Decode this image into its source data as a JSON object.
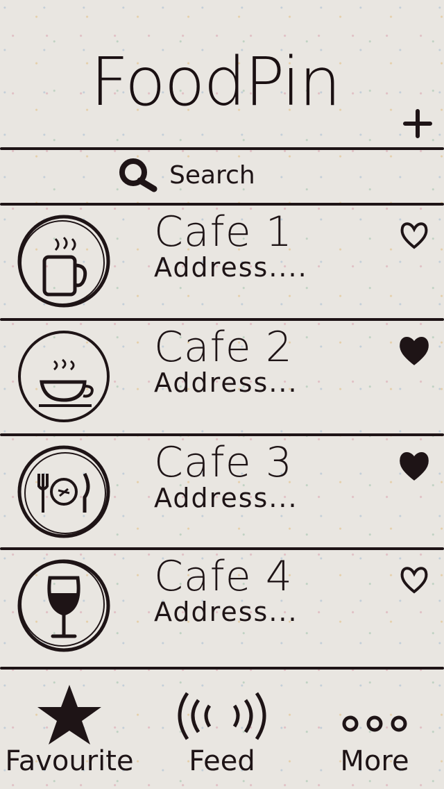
{
  "nav": {
    "title": "FoodPin",
    "add_icon": "plus-icon"
  },
  "search": {
    "placeholder": "Search",
    "icon": "search-icon"
  },
  "restaurants": [
    {
      "name": "Cafe 1",
      "address": "Address....",
      "icon": "coffee-mug-icon",
      "favorited": false
    },
    {
      "name": "Cafe 2",
      "address": "Address...",
      "icon": "coffee-cup-icon",
      "favorited": true
    },
    {
      "name": "Cafe 3",
      "address": "Address...",
      "icon": "plate-cutlery-icon",
      "favorited": true
    },
    {
      "name": "Cafe 4",
      "address": "Address...",
      "icon": "wine-glass-icon",
      "favorited": false
    }
  ],
  "tabs": [
    {
      "label": "Favourite",
      "icon": "star-icon"
    },
    {
      "label": "Feed",
      "icon": "broadcast-icon"
    },
    {
      "label": "More",
      "icon": "more-dots-icon"
    }
  ],
  "colors": {
    "ink": "#1e1416",
    "paper": "#e9e6e1"
  }
}
